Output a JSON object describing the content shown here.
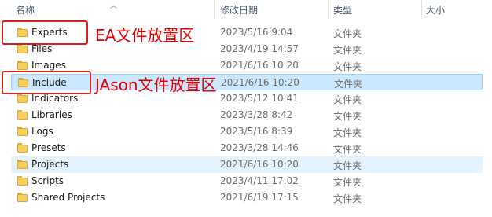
{
  "columns": {
    "name": "名称",
    "date": "修改日期",
    "type": "类型",
    "size": "大小"
  },
  "rows": [
    {
      "name": "Experts",
      "date": "2023/5/16 9:04",
      "type": "文件夹"
    },
    {
      "name": "Files",
      "date": "2023/4/19 14:57",
      "type": "文件夹"
    },
    {
      "name": "Images",
      "date": "2021/6/16 10:20",
      "type": "文件夹"
    },
    {
      "name": "Include",
      "date": "2021/6/16 10:20",
      "type": "文件夹"
    },
    {
      "name": "Indicators",
      "date": "2023/5/12 10:41",
      "type": "文件夹"
    },
    {
      "name": "Libraries",
      "date": "2023/3/28 8:42",
      "type": "文件夹"
    },
    {
      "name": "Logs",
      "date": "2023/5/16 8:39",
      "type": "文件夹"
    },
    {
      "name": "Presets",
      "date": "2023/3/28 14:46",
      "type": "文件夹"
    },
    {
      "name": "Projects",
      "date": "2021/6/16 10:20",
      "type": "文件夹"
    },
    {
      "name": "Scripts",
      "date": "2023/4/11 17:02",
      "type": "文件夹"
    },
    {
      "name": "Shared Projects",
      "date": "2021/6/19 17:15",
      "type": "文件夹"
    }
  ],
  "annotations": {
    "experts": "EA文件放置区",
    "include": "JAson文件放置区"
  },
  "colors": {
    "annotation": "#e60000",
    "selected_bg": "#cce8ff",
    "hover_bg": "#e5f3ff",
    "folder": "#f8cf5a"
  },
  "icons": {
    "folder": "folder-icon",
    "sort": "chevron-up-icon"
  }
}
